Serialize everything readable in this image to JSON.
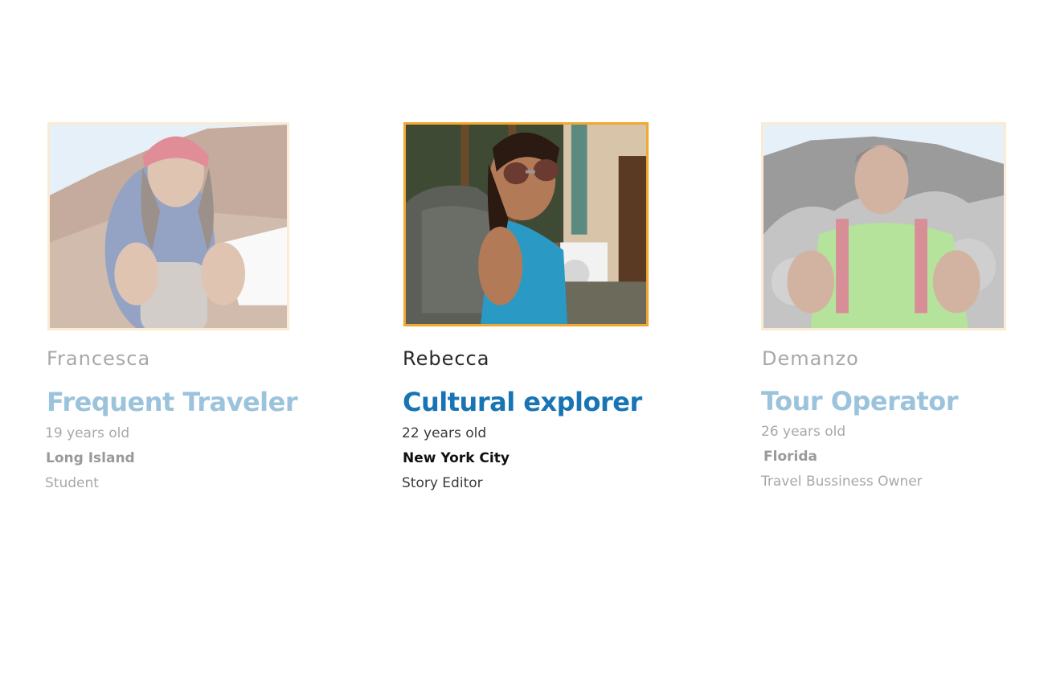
{
  "personas": [
    {
      "name": "Francesca",
      "role": "Frequent Traveler",
      "age": "19 years old",
      "location": "Long Island",
      "occupation": "Student",
      "state": "faded",
      "photo_icon": "traveler-woman-photo"
    },
    {
      "name": "Rebecca",
      "role": "Cultural explorer",
      "age": "22 years old",
      "location": "New York City",
      "occupation": "Story Editor",
      "state": "active",
      "photo_icon": "traveler-woman-sunglasses-photo"
    },
    {
      "name": "Demanzo",
      "role": "Tour Operator",
      "age": "26 years old",
      "location": "Florida",
      "occupation": "Travel Bussiness Owner",
      "state": "faded",
      "photo_icon": "traveler-man-photo"
    }
  ],
  "colors": {
    "active_role": "#1874b4",
    "faded_role": "#9cc3dc",
    "active_border": "#f0a830",
    "faded_border": "#f6d9a6"
  }
}
